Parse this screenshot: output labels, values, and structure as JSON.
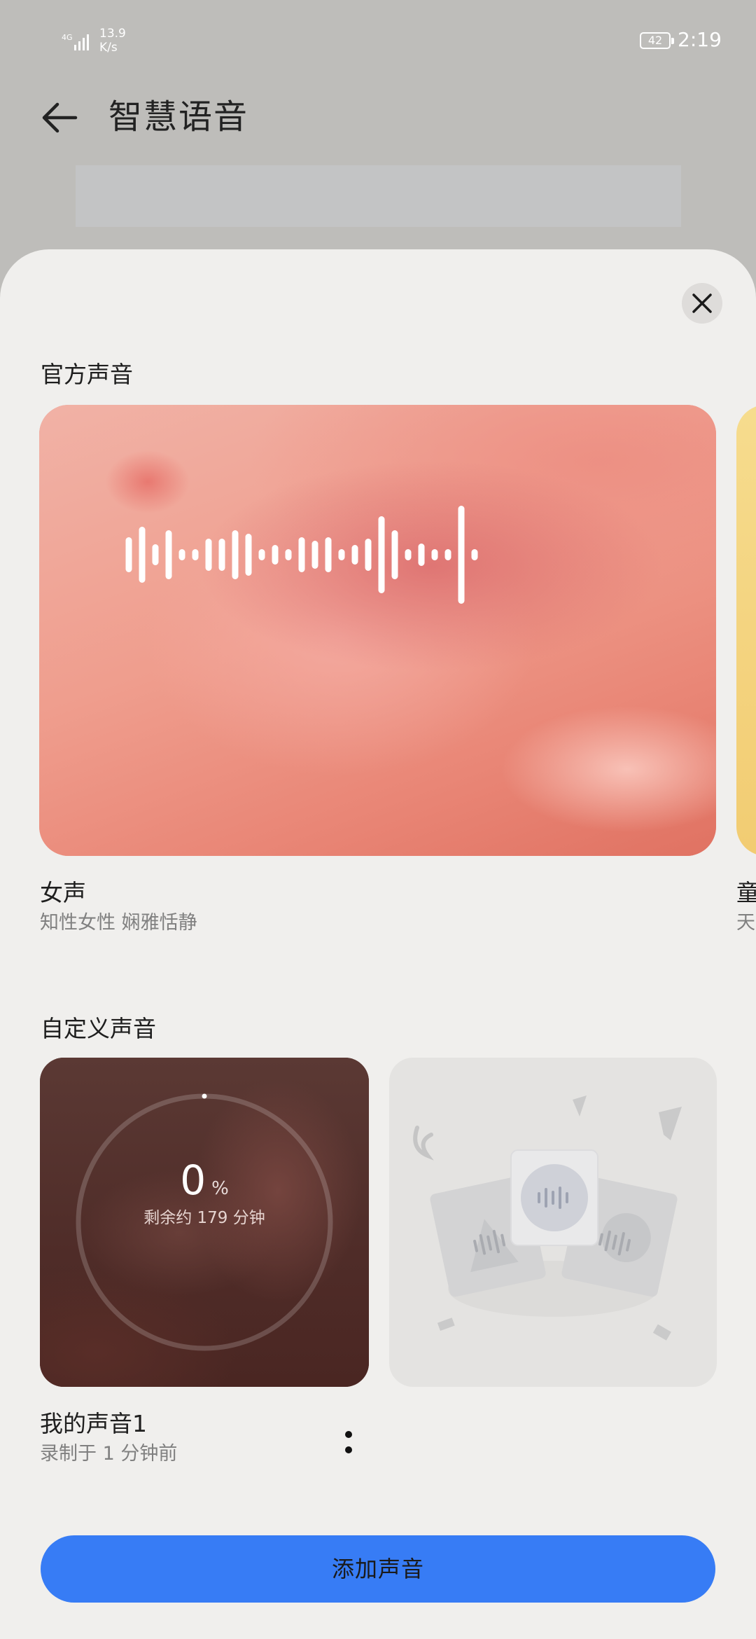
{
  "status_bar": {
    "network": "4G",
    "net_speed_value": "13.9",
    "net_speed_unit": "K/s",
    "battery": "42",
    "time": "2:19"
  },
  "header": {
    "title": "智慧语音"
  },
  "sheet": {
    "official_section_title": "官方声音",
    "official_voices": [
      {
        "name": "女声",
        "description": "知性女性 娴雅恬静"
      },
      {
        "name": "童",
        "description": "天"
      }
    ],
    "custom_section_title": "自定义声音",
    "custom_voices": [
      {
        "progress_value": "0",
        "progress_unit": "%",
        "progress_fraction": 0,
        "remaining": "剩余约 179 分钟",
        "name": "我的声音1",
        "recorded": "录制于 1 分钟前"
      }
    ],
    "add_button_label": "添加声音"
  },
  "colors": {
    "accent_blue": "#377cf5",
    "sheet_background": "#f0efed",
    "official_card_color": "#ea9a8c",
    "custom_card_color": "#5a3530"
  },
  "icons": {
    "back": "arrow-left-icon",
    "close": "close-icon",
    "more": "more-vertical-icon"
  }
}
